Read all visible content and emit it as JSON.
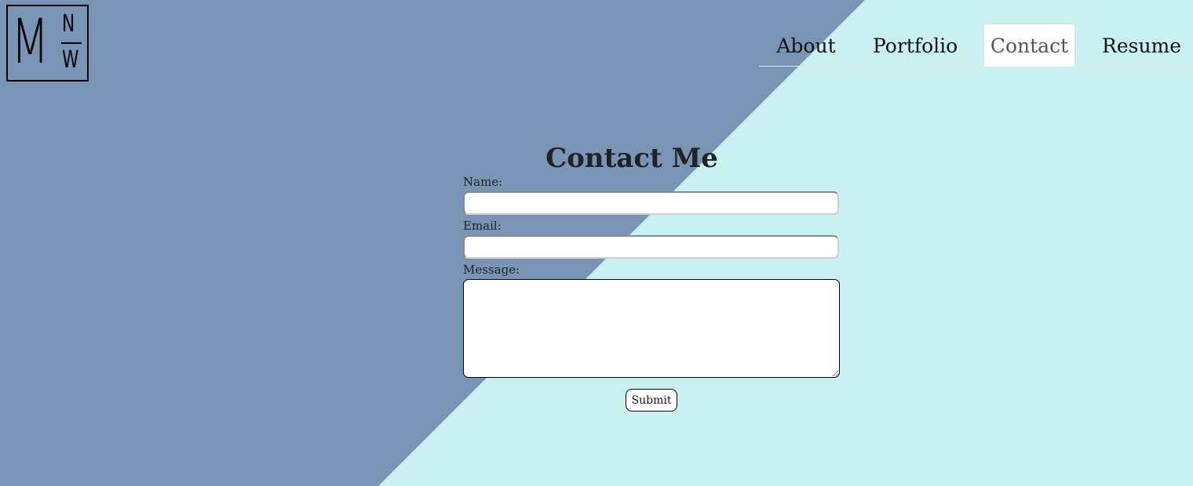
{
  "colors": {
    "left_panel": "#7995b5",
    "right_panel": "#caf1f2"
  },
  "logo": {
    "big_letter": "M",
    "top_letter": "N",
    "bottom_letter": "W"
  },
  "nav": {
    "items": [
      {
        "label": "About",
        "active": false
      },
      {
        "label": "Portfolio",
        "active": false
      },
      {
        "label": "Contact",
        "active": true
      },
      {
        "label": "Resume",
        "active": false
      }
    ]
  },
  "contact": {
    "heading": "Contact Me",
    "name_label": "Name:",
    "name_value": "",
    "email_label": "Email:",
    "email_value": "",
    "message_label": "Message:",
    "message_value": "",
    "submit_label": "Submit"
  }
}
